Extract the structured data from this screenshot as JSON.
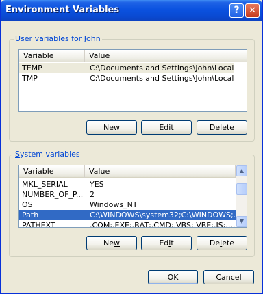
{
  "window": {
    "title": "Environment Variables",
    "help_glyph": "?",
    "close_glyph": "✕"
  },
  "user_vars": {
    "group_prefix": "",
    "group_accel": "U",
    "group_rest": "ser variables for John",
    "columns": [
      "Variable",
      "Value"
    ],
    "rows": [
      {
        "name": "TEMP",
        "value": "C:\\Documents and Settings\\John\\Local ..."
      },
      {
        "name": "TMP",
        "value": "C:\\Documents and Settings\\John\\Local ..."
      }
    ],
    "buttons": {
      "new": {
        "pre": "",
        "accel": "N",
        "post": "ew"
      },
      "edit": {
        "pre": "",
        "accel": "E",
        "post": "dit"
      },
      "delete": {
        "pre": "",
        "accel": "D",
        "post": "elete"
      }
    }
  },
  "system_vars": {
    "group_accel": "S",
    "group_rest": "ystem variables",
    "columns": [
      "Variable",
      "Value"
    ],
    "rows": [
      {
        "name": "MKL_SERIAL",
        "value": "YES"
      },
      {
        "name": "NUMBER_OF_P...",
        "value": "2"
      },
      {
        "name": "OS",
        "value": "Windows_NT"
      },
      {
        "name": "Path",
        "value": "C:\\WINDOWS\\system32;C:\\WINDOWS;..."
      },
      {
        "name": "PATHEXT",
        "value": ".COM;.EXE;.BAT;.CMD;.VBS;.VBE;.JS;...."
      }
    ],
    "buttons": {
      "new": {
        "pre": "Ne",
        "accel": "w",
        "post": ""
      },
      "edit": {
        "pre": "Ed",
        "accel": "i",
        "post": "t"
      },
      "delete": {
        "pre": "De",
        "accel": "l",
        "post": "ete"
      }
    },
    "scrollbar": {
      "up_glyph": "▲",
      "down_glyph": "▼"
    }
  },
  "footer": {
    "ok": "OK",
    "cancel": "Cancel"
  }
}
